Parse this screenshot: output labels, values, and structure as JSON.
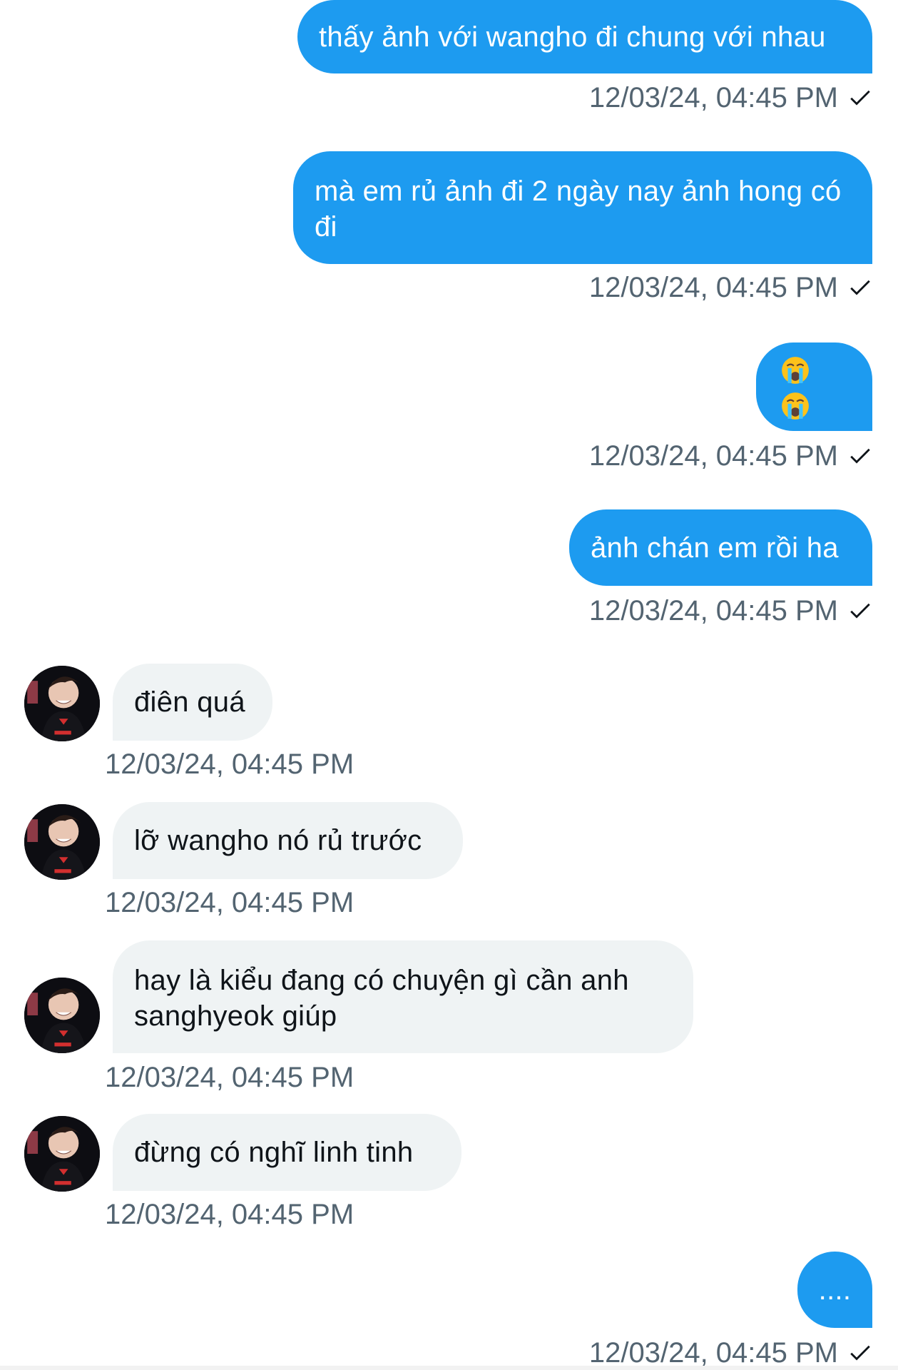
{
  "colors": {
    "outgoing_bubble": "#1d9bf0",
    "incoming_bubble": "#eff3f4",
    "timestamp": "#536471",
    "outgoing_text": "#ffffff",
    "incoming_text": "#0f1419"
  },
  "messages": [
    {
      "direction": "outgoing",
      "text": "thấy ảnh với wangho đi chung với nhau",
      "time": "12/03/24, 04:45 PM",
      "status_icon": "check-icon"
    },
    {
      "direction": "outgoing",
      "text": "mà em rủ ảnh đi 2 ngày nay ảnh hong có đi",
      "time": "12/03/24, 04:45 PM",
      "status_icon": "check-icon"
    },
    {
      "direction": "outgoing",
      "text": "😭😭",
      "time": "12/03/24, 04:45 PM",
      "status_icon": "check-icon",
      "icons": [
        "loudly-crying-face-icon",
        "loudly-crying-face-icon"
      ]
    },
    {
      "direction": "outgoing",
      "text": "ảnh chán em rồi ha",
      "time": "12/03/24, 04:45 PM",
      "status_icon": "check-icon"
    },
    {
      "direction": "incoming",
      "text": "điên quá",
      "time": "12/03/24, 04:45 PM",
      "avatar_icon": "profile-avatar"
    },
    {
      "direction": "incoming",
      "text": "lỡ wangho nó rủ trước",
      "time": "12/03/24, 04:45 PM",
      "avatar_icon": "profile-avatar"
    },
    {
      "direction": "incoming",
      "text": "hay là kiểu đang có chuyện gì cần anh sanghyeok giúp",
      "time": "12/03/24, 04:45 PM",
      "avatar_icon": "profile-avatar"
    },
    {
      "direction": "incoming",
      "text": "đừng có nghĩ linh tinh",
      "time": "12/03/24, 04:45 PM",
      "avatar_icon": "profile-avatar"
    },
    {
      "direction": "outgoing",
      "text": "....",
      "time": "12/03/24, 04:45 PM",
      "status_icon": "check-icon"
    }
  ]
}
